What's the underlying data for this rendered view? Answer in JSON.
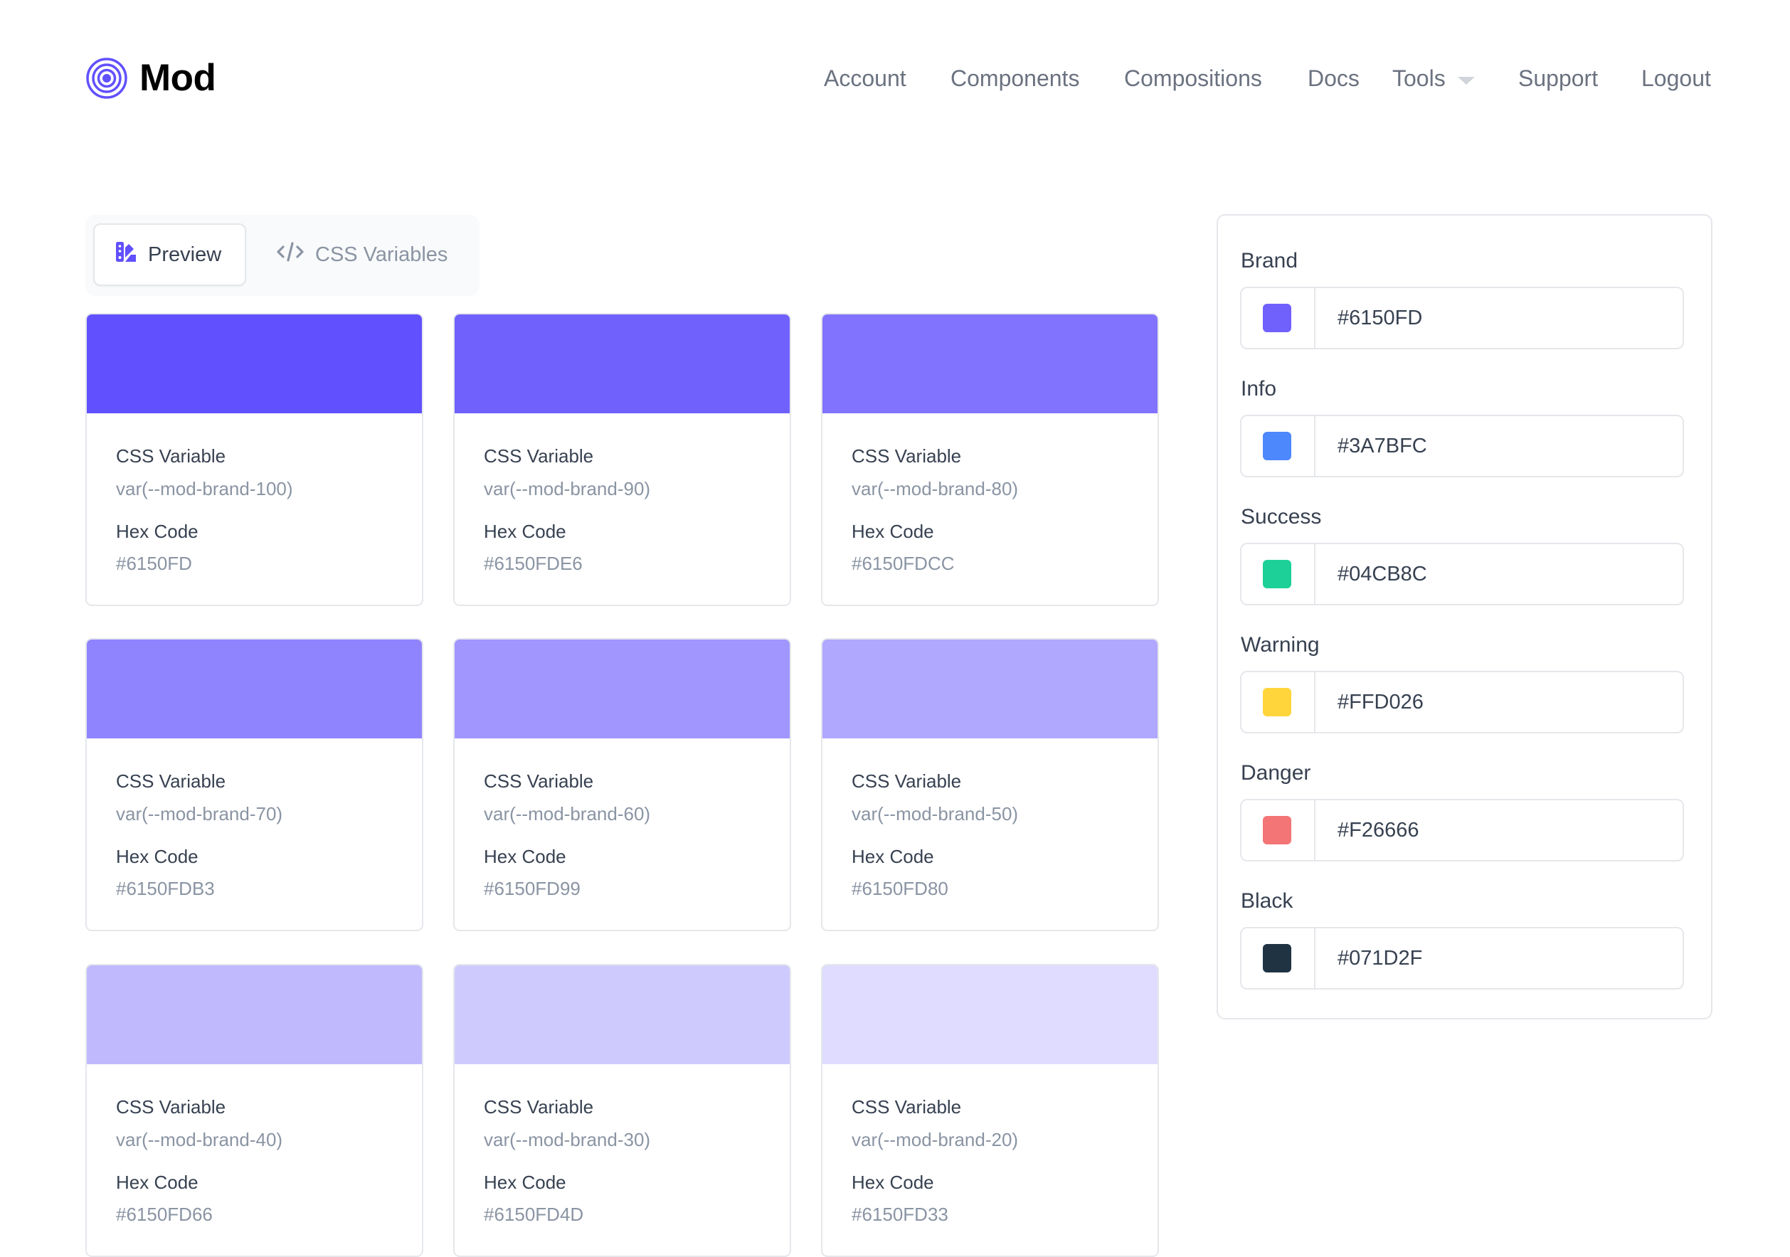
{
  "header": {
    "brand_name": "Mod",
    "logo_color": "#6150FD",
    "nav": [
      {
        "label": "Account"
      },
      {
        "label": "Components"
      },
      {
        "label": "Compositions"
      },
      {
        "label": "Docs"
      },
      {
        "label": "Tools",
        "has_dropdown": true
      },
      {
        "label": "Support"
      },
      {
        "label": "Logout"
      }
    ]
  },
  "tabs": {
    "active": "Preview",
    "items": [
      {
        "label": "Preview",
        "icon": "swatch-book-icon"
      },
      {
        "label": "CSS Variables",
        "icon": "code-icon"
      }
    ]
  },
  "cards": {
    "css_variable_label": "CSS Variable",
    "hex_code_label": "Hex Code",
    "items": [
      {
        "css_variable": "var(--mod-brand-100)",
        "hex": "#6150FD"
      },
      {
        "css_variable": "var(--mod-brand-90)",
        "hex": "#6150FDE6"
      },
      {
        "css_variable": "var(--mod-brand-80)",
        "hex": "#6150FDCC"
      },
      {
        "css_variable": "var(--mod-brand-70)",
        "hex": "#6150FDB3"
      },
      {
        "css_variable": "var(--mod-brand-60)",
        "hex": "#6150FD99"
      },
      {
        "css_variable": "var(--mod-brand-50)",
        "hex": "#6150FD80"
      },
      {
        "css_variable": "var(--mod-brand-40)",
        "hex": "#6150FD66"
      },
      {
        "css_variable": "var(--mod-brand-30)",
        "hex": "#6150FD4D"
      },
      {
        "css_variable": "var(--mod-brand-20)",
        "hex": "#6150FD33"
      }
    ]
  },
  "palette": {
    "items": [
      {
        "label": "Brand",
        "hex": "#6150FD"
      },
      {
        "label": "Info",
        "hex": "#3A7BFC"
      },
      {
        "label": "Success",
        "hex": "#04CB8C"
      },
      {
        "label": "Warning",
        "hex": "#FFD026"
      },
      {
        "label": "Danger",
        "hex": "#F26666"
      },
      {
        "label": "Black",
        "hex": "#071D2F"
      }
    ]
  }
}
